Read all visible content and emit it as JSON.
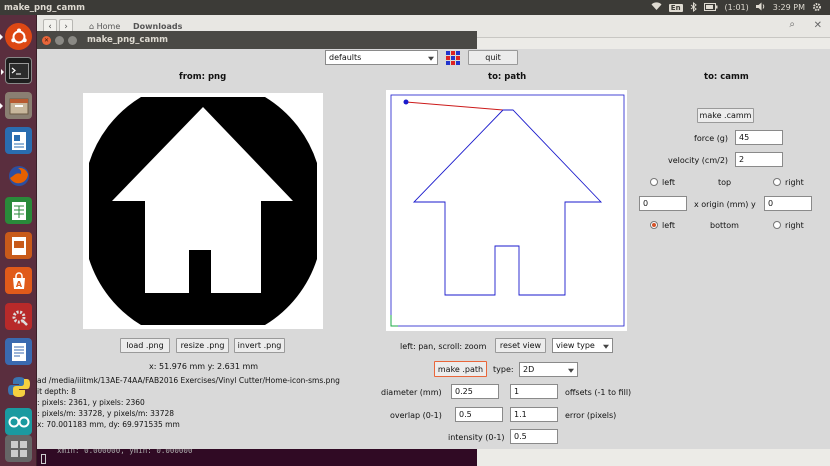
{
  "top_panel": {
    "title": "make_png_camm",
    "keyboard": "En",
    "battery": "(1:01)",
    "time": "3:29 PM"
  },
  "file_manager": {
    "home_label": "Home",
    "downloads_label": "Downloads"
  },
  "window": {
    "title": "make_png_camm"
  },
  "toolbar": {
    "defaults_value": "defaults",
    "quit_label": "quit"
  },
  "from_png": {
    "header": "from: png",
    "load_label": "load .png",
    "resize_label": "resize .png",
    "invert_label": "invert .png",
    "coords": "x: 51.976 mm  y: 2.631 mm",
    "info": [
      "ad /media/iiitmk/13AE-74AA/FAB2016 Exercises/Vinyl Cutter/Home-icon-sms.png",
      "it depth: 8",
      ": pixels: 2361, y pixels: 2360",
      ": pixels/m: 33728, y pixels/m: 33728",
      "x: 70.001183 mm, dy: 69.971535 mm"
    ]
  },
  "to_path": {
    "header": "to: path",
    "hint": "left: pan, scroll: zoom",
    "reset_view_label": "reset view",
    "view_type_value": "view type",
    "make_path_label": "make .path",
    "type_label": "type:",
    "type_value": "2D",
    "diameter_label": "diameter (mm)",
    "diameter_value": "0.25",
    "offsets_value": "1",
    "offsets_label": "offsets (-1 to fill)",
    "overlap_label": "overlap (0-1)",
    "overlap_value": "0.5",
    "error_value": "1.1",
    "error_label": "error (pixels)",
    "intensity_label": "intensity (0-1)",
    "intensity_value": "0.5"
  },
  "to_camm": {
    "header": "to: camm",
    "make_camm_label": "make .camm",
    "force_label": "force (g)",
    "force_value": "45",
    "velocity_label": "velocity (cm/2)",
    "velocity_value": "2",
    "left_label_1": "left",
    "top_label": "top",
    "right_label_1": "right",
    "origin_x_value": "0",
    "origin_label": "x  origin (mm)  y",
    "origin_y_value": "0",
    "left_label_2": "left",
    "bottom_label": "bottom",
    "right_label_2": "right",
    "selected_origin": "left-bottom"
  },
  "terminal": {
    "line": "xmin: 0.000000, ymin: 0.000000"
  },
  "colors": {
    "path_blue": "#1a1acc",
    "path_red": "#cc1a1a",
    "accent_orange": "#e9663a"
  }
}
